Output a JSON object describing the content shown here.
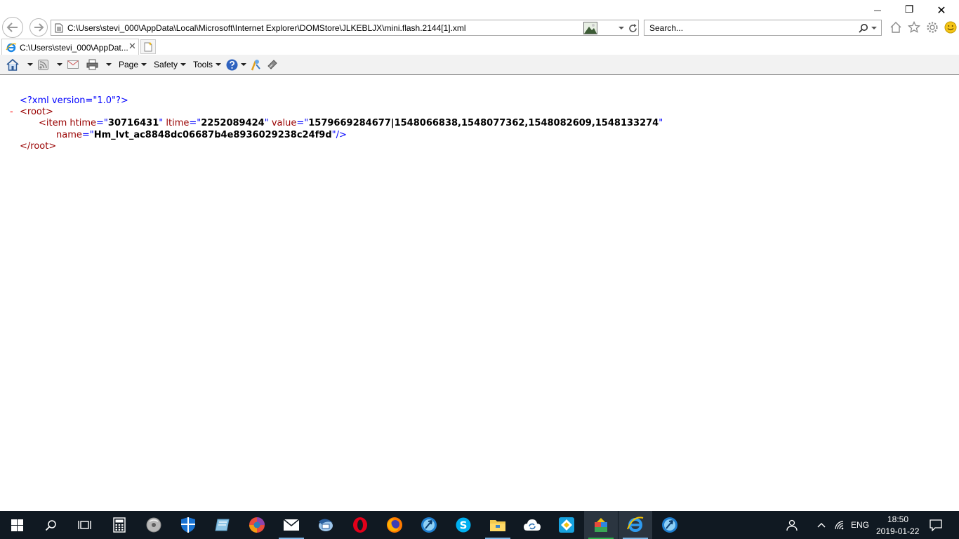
{
  "window": {
    "minimize_glyph": "—",
    "restore_glyph": "❐",
    "close_glyph": "✕"
  },
  "address_bar": {
    "url": "C:\\Users\\stevi_000\\AppData\\Local\\Microsoft\\Internet Explorer\\DOMStore\\JLKEBLJX\\mini.flash.2144[1].xml"
  },
  "search": {
    "placeholder": "Search..."
  },
  "tab": {
    "title": "C:\\Users\\stevi_000\\AppDat...",
    "close_glyph": "✕"
  },
  "command_bar": {
    "page_label": "Page",
    "safety_label": "Safety",
    "tools_label": "Tools"
  },
  "xml": {
    "declaration": "<?xml version=\"1.0\"?>",
    "collapse_marker": "-",
    "root_open": "<root>",
    "item_open": "<item",
    "attr_htime": "htime",
    "val_htime": "30716431",
    "attr_ltime": "ltime",
    "val_ltime": "2252089424",
    "attr_value": "value",
    "val_value": "1579669284677|1548066838,1548077362,1548082609,1548133274",
    "attr_name": "name",
    "val_name": "Hm_lvt_ac8848dc06687b4e8936029238c24f9d",
    "item_close": "/>",
    "root_close": "</root>"
  },
  "taskbar": {
    "language": "ENG",
    "time": "18:50",
    "date": "2019-01-22"
  },
  "colors": {
    "xml_pi": "#0000ff",
    "xml_tag": "#990000",
    "taskbar_bg": "#101922"
  }
}
